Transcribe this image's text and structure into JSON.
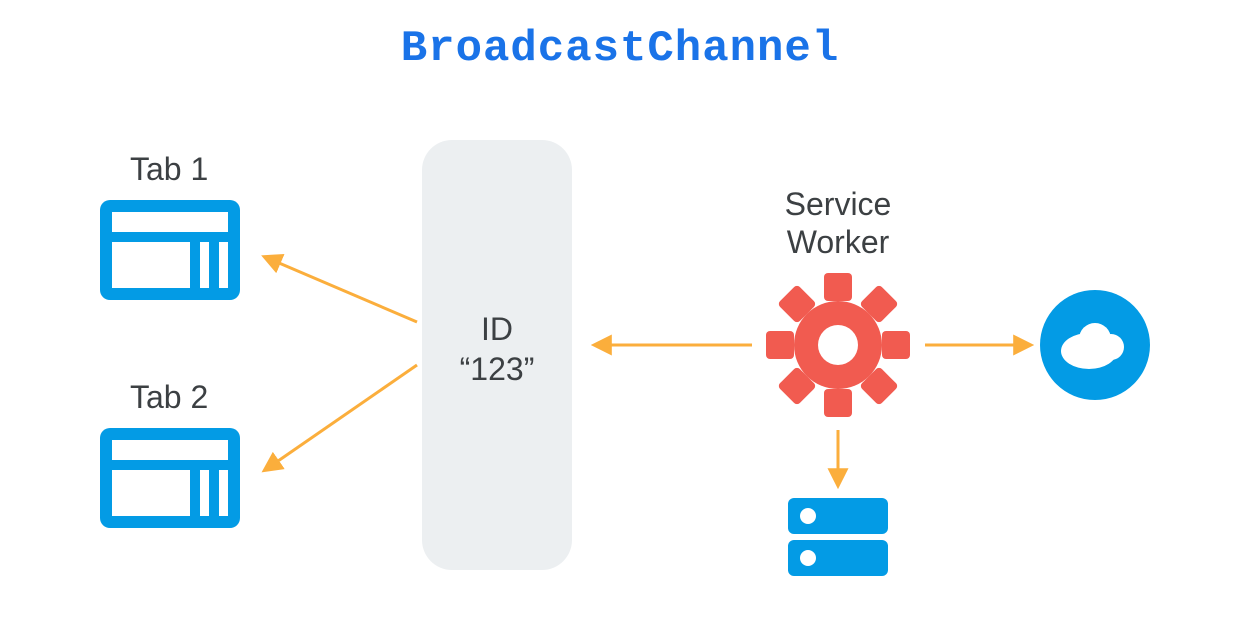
{
  "title": "BroadcastChannel",
  "tabs": [
    {
      "label": "Tab 1"
    },
    {
      "label": "Tab 2"
    }
  ],
  "channel": {
    "id_label_line1": "ID",
    "id_label_line2": "“123”"
  },
  "service_worker": {
    "label_line1": "Service",
    "label_line2": "Worker"
  },
  "icons": {
    "tab": "browser-window-icon",
    "gear": "gear-icon",
    "cloud": "cloud-icon",
    "server": "server-icon"
  },
  "colors": {
    "brand_blue": "#1a73e8",
    "icon_blue": "#039be5",
    "accent_red": "#f15b50",
    "arrow_orange": "#fbae3c",
    "panel_gray": "#eceff1",
    "text": "#3c4043"
  }
}
